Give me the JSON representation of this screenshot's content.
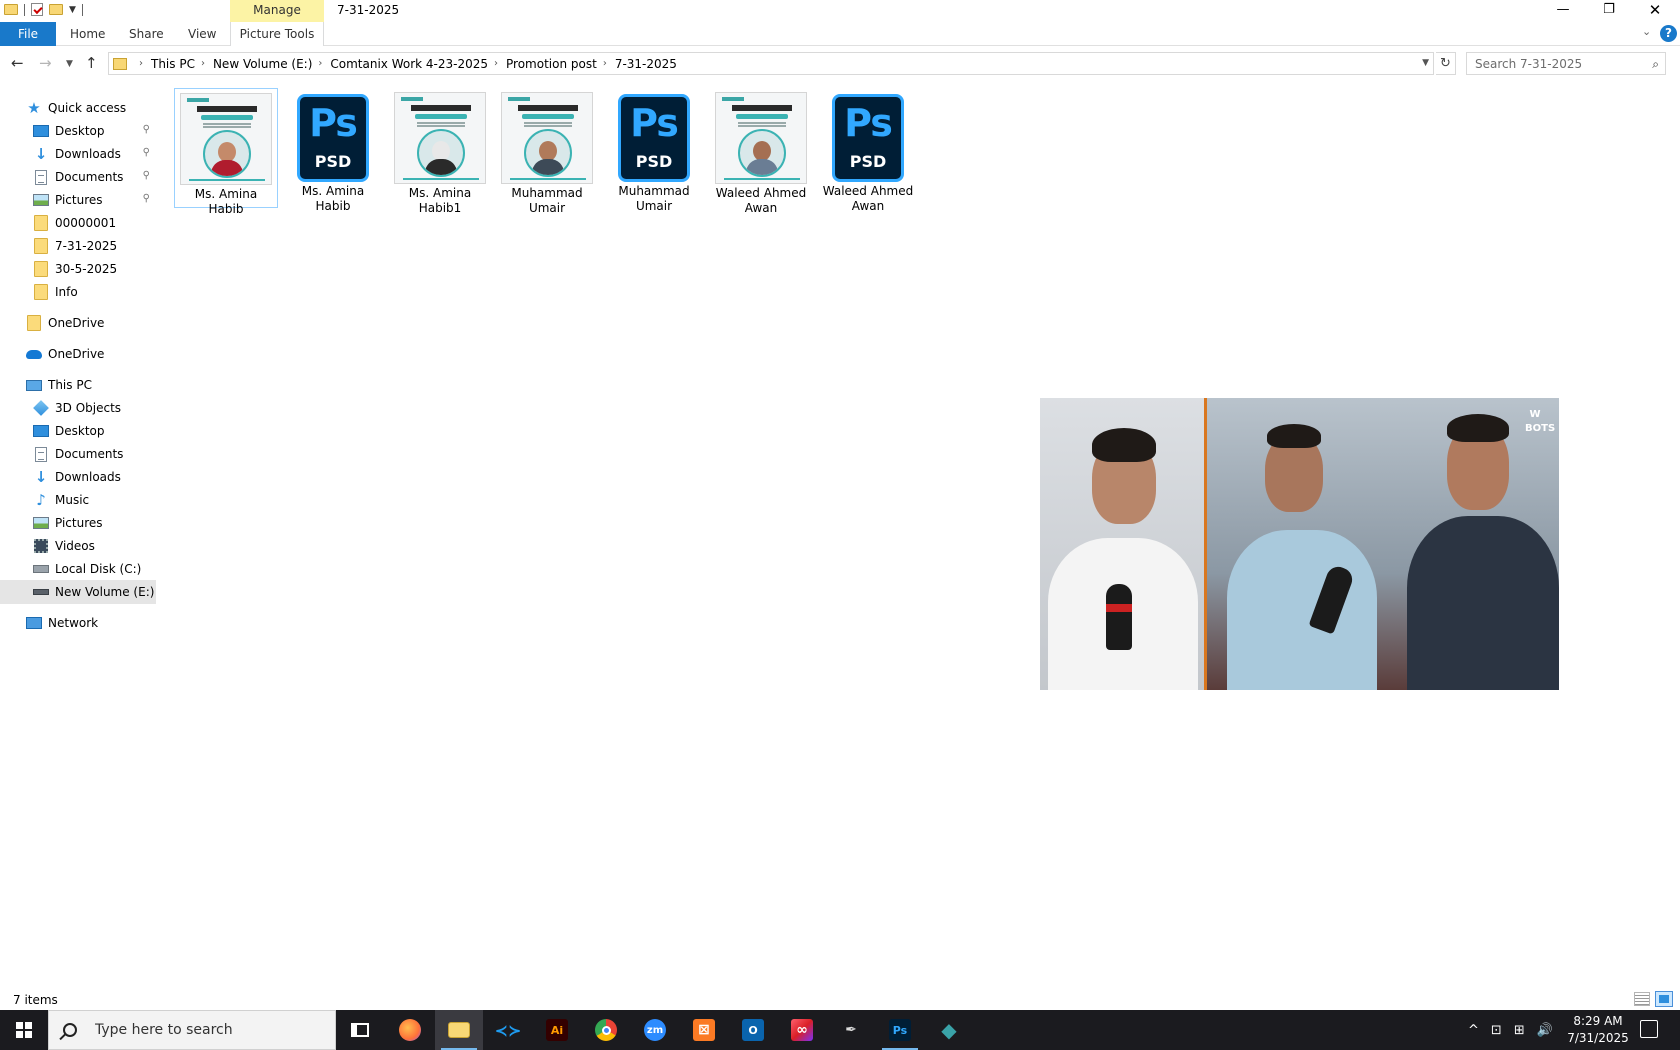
{
  "window": {
    "title": "7-31-2025",
    "contextual_group": "Manage",
    "controls": {
      "minimize": "—",
      "maximize": "❐",
      "close": "✕"
    }
  },
  "ribbon": {
    "tabs": [
      "File",
      "Home",
      "Share",
      "View",
      "Picture Tools"
    ],
    "expand_glyph": "⌄",
    "help_glyph": "?"
  },
  "address": {
    "breadcrumbs": [
      "This PC",
      "New Volume (E:)",
      "Comtanix Work 4-23-2025",
      "Promotion post",
      "7-31-2025"
    ],
    "separator": "›",
    "search_placeholder": "Search 7-31-2025"
  },
  "nav": {
    "quick_access": "Quick access",
    "pinned": [
      {
        "label": "Desktop",
        "icon": "desktop-icon",
        "pinned": true
      },
      {
        "label": "Downloads",
        "icon": "downloads-icon",
        "pinned": true
      },
      {
        "label": "Documents",
        "icon": "documents-icon",
        "pinned": true
      },
      {
        "label": "Pictures",
        "icon": "pictures-icon",
        "pinned": true
      },
      {
        "label": "00000001",
        "icon": "folder-icon",
        "pinned": false
      },
      {
        "label": "7-31-2025",
        "icon": "folder-icon",
        "pinned": false
      },
      {
        "label": "30-5-2025",
        "icon": "folder-icon",
        "pinned": false
      },
      {
        "label": "Info",
        "icon": "folder-icon",
        "pinned": false
      }
    ],
    "onedrive_1": "OneDrive",
    "onedrive_2": "OneDrive",
    "this_pc": "This PC",
    "pc_items": [
      {
        "label": "3D Objects",
        "icon": "3d-objects-icon"
      },
      {
        "label": "Desktop",
        "icon": "desktop-icon"
      },
      {
        "label": "Documents",
        "icon": "documents-icon"
      },
      {
        "label": "Downloads",
        "icon": "downloads-icon"
      },
      {
        "label": "Music",
        "icon": "music-icon"
      },
      {
        "label": "Pictures",
        "icon": "pictures-icon"
      },
      {
        "label": "Videos",
        "icon": "videos-icon"
      },
      {
        "label": "Local Disk (C:)",
        "icon": "local-disk-icon"
      },
      {
        "label": "New Volume (E:)",
        "icon": "drive-icon",
        "selected": true
      }
    ],
    "network": "Network",
    "pin_glyph": "📌"
  },
  "files": [
    {
      "name": "Ms. Amina Habib",
      "type": "image",
      "person_color": "#b01c2e",
      "skin": "#c48a6a",
      "selected": true
    },
    {
      "name": "Ms. Amina Habib",
      "type": "psd"
    },
    {
      "name": "Ms. Amina Habib1",
      "type": "image",
      "person_color": "#2a2a2a",
      "skin": "#e8e8e8",
      "selected": false
    },
    {
      "name": "Muhammad Umair",
      "type": "image",
      "person_color": "#3d4a57",
      "skin": "#b07a5a",
      "selected": false
    },
    {
      "name": "Muhammad Umair",
      "type": "psd"
    },
    {
      "name": "Waleed Ahmed Awan",
      "type": "image",
      "person_color": "#6a7d94",
      "skin": "#a56f52",
      "selected": false
    },
    {
      "name": "Waleed Ahmed Awan",
      "type": "psd"
    }
  ],
  "psd_icon": {
    "logo": "Ps",
    "label": "PSD"
  },
  "thumbnail_text": {
    "brand": "Comtanix",
    "heading": "CONGRATULATIONS"
  },
  "video": {
    "logo": "W\nBOTS"
  },
  "status": {
    "item_count": "7 items"
  },
  "taskbar": {
    "search_placeholder": "Type here to search",
    "apps": [
      {
        "name": "task-view",
        "active": false,
        "running": false
      },
      {
        "name": "firefox",
        "color": "#ff7139",
        "glyph": "",
        "running": false
      },
      {
        "name": "file-explorer",
        "color": "#f8d775",
        "glyph": "",
        "running": true,
        "active": true
      },
      {
        "name": "vscode",
        "color": "#1f9cf0",
        "glyph": "≺≻",
        "running": false
      },
      {
        "name": "illustrator",
        "color": "#330000",
        "glyph": "Ai",
        "running": false
      },
      {
        "name": "chrome",
        "color": "#4285f4",
        "glyph": "",
        "running": false
      },
      {
        "name": "zoom",
        "color": "#2d8cff",
        "glyph": "zm",
        "running": false
      },
      {
        "name": "xampp",
        "color": "#fb7a24",
        "glyph": "⊠",
        "running": false
      },
      {
        "name": "outlook",
        "color": "#0a64ad",
        "glyph": "O",
        "running": false
      },
      {
        "name": "creative-cloud",
        "color": "#da1f26",
        "glyph": "∞",
        "running": false
      },
      {
        "name": "pen-tool",
        "color": "transparent",
        "glyph": "✒",
        "running": false
      },
      {
        "name": "photoshop",
        "color": "#001e36",
        "glyph": "Ps",
        "running": true
      },
      {
        "name": "app-diamond",
        "color": "#3aa3a8",
        "glyph": "◆",
        "running": false
      }
    ],
    "tray": [
      "^",
      "⊡",
      "⊞",
      "🔊"
    ],
    "time": "8:29 AM",
    "date": "7/31/2025"
  }
}
